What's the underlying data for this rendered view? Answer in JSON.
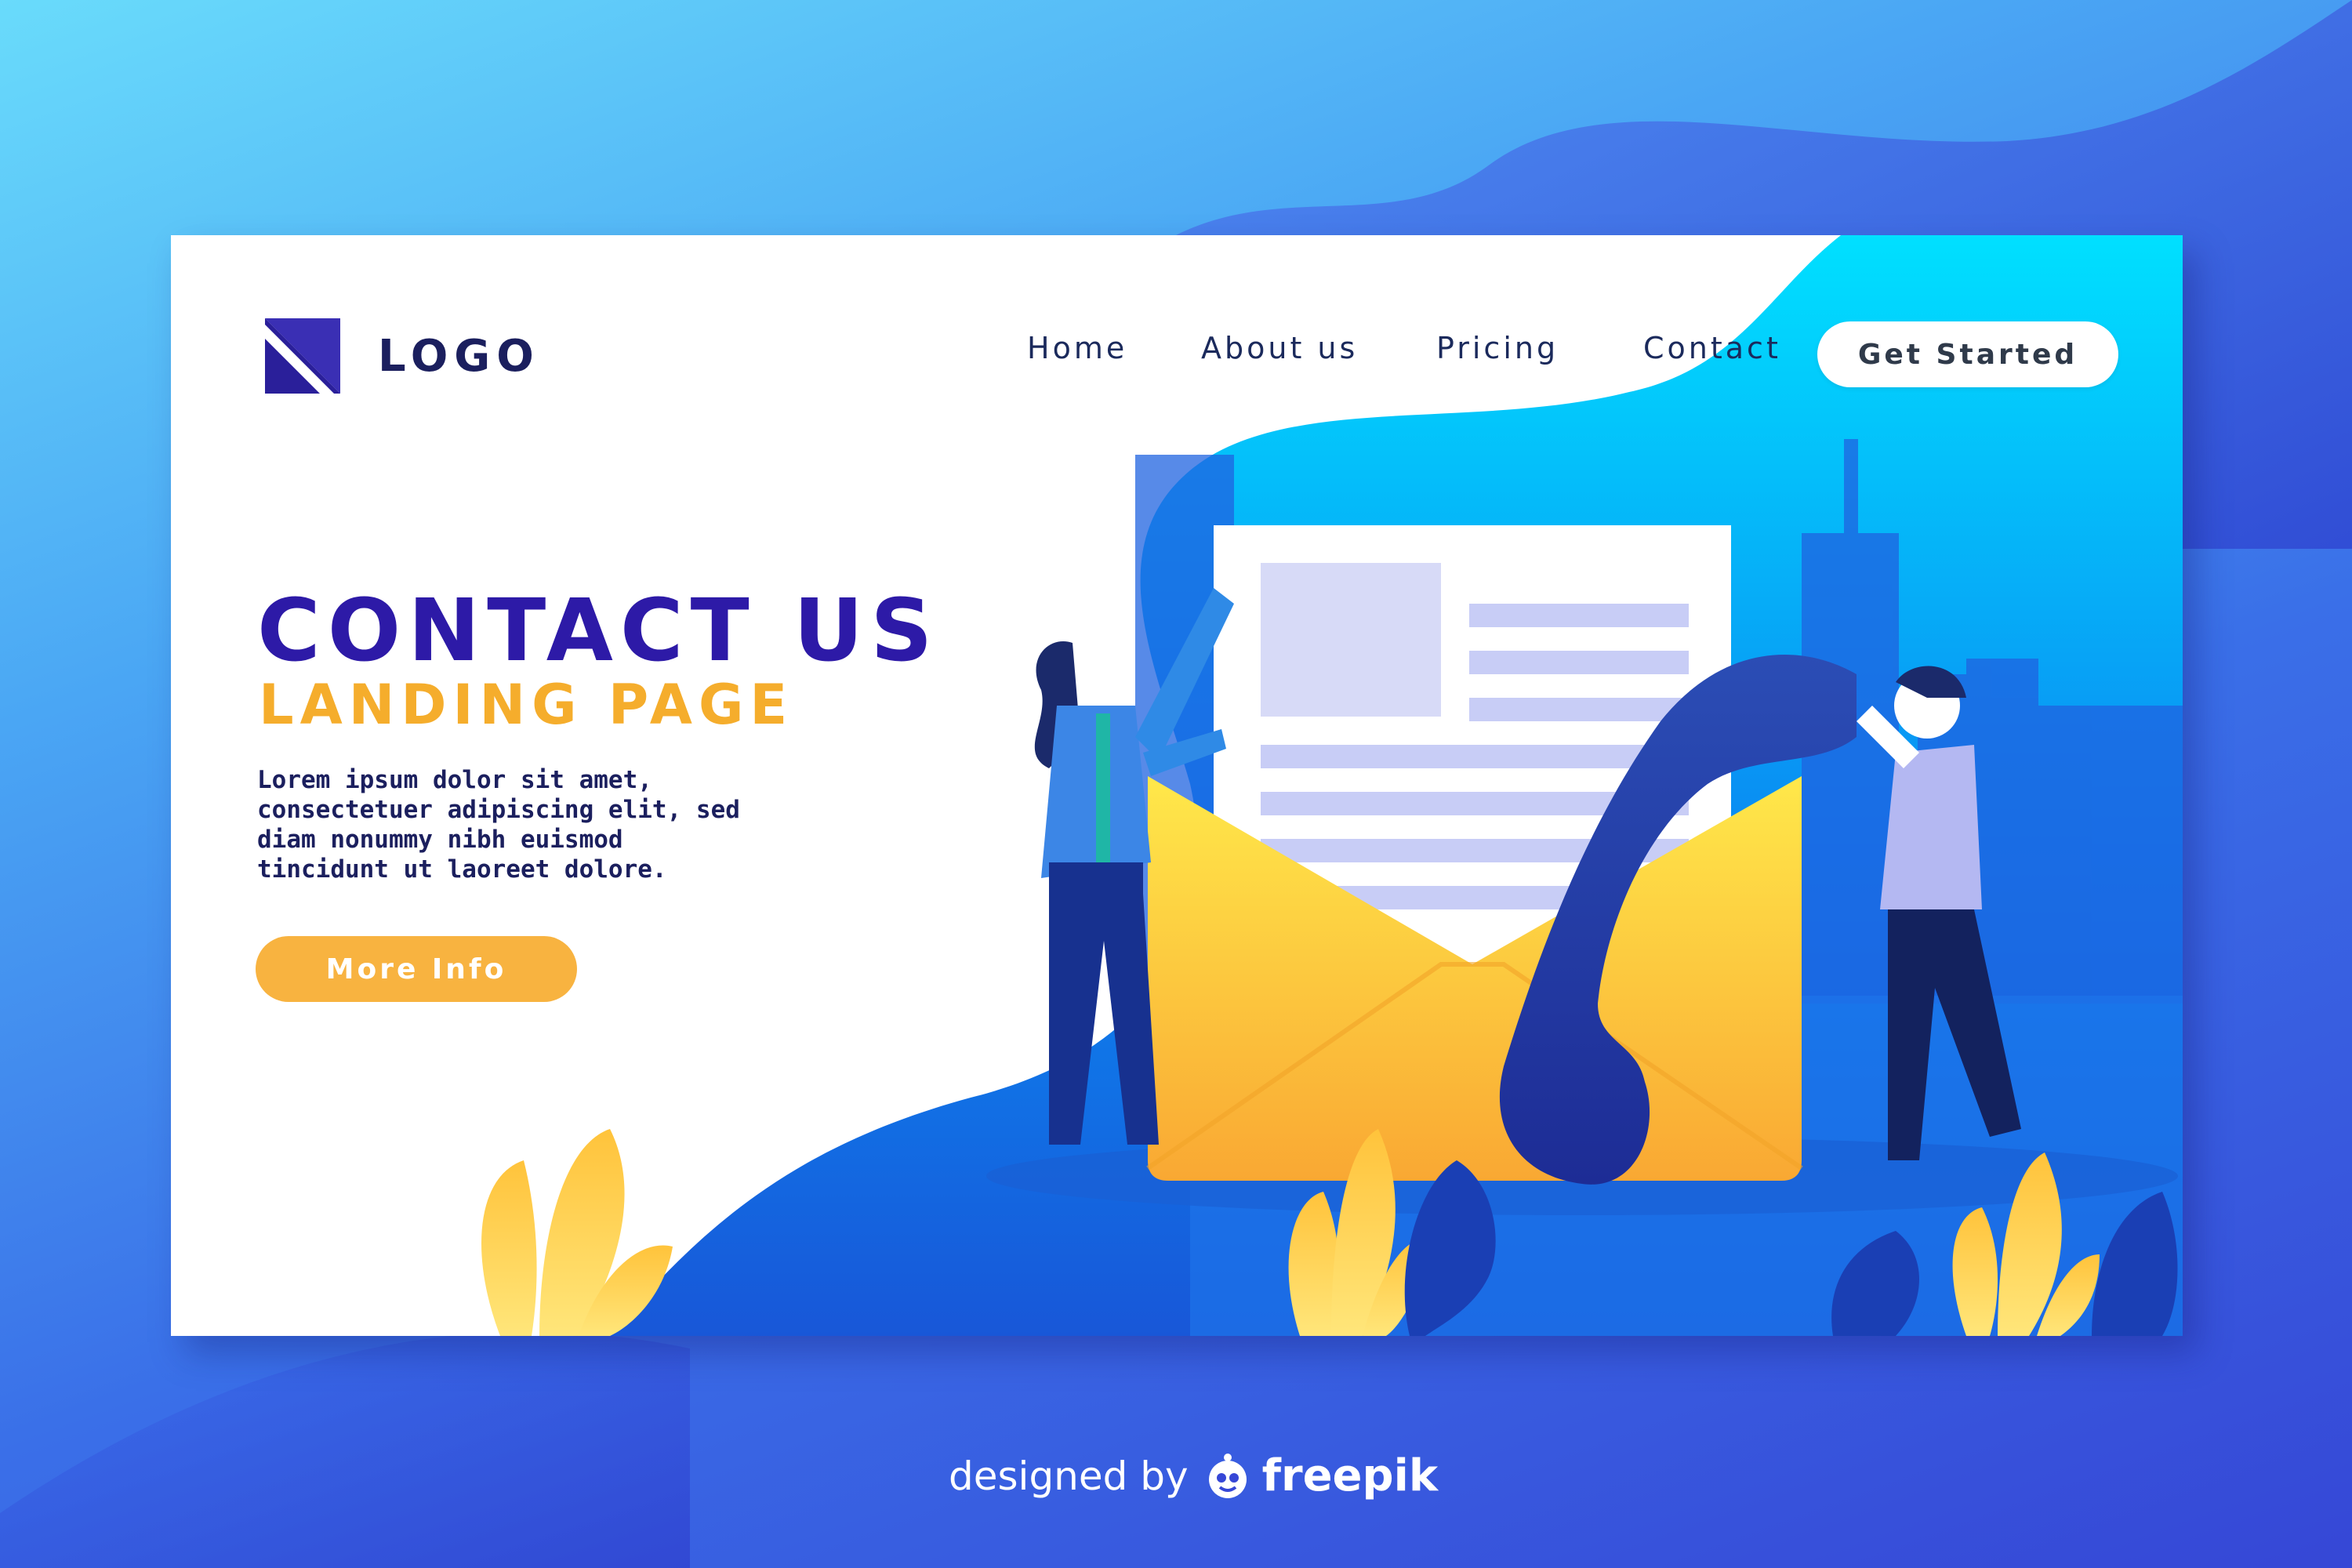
{
  "logo": {
    "text": "LOGO",
    "icon": "square-logo-icon"
  },
  "nav": {
    "items": [
      "Home",
      "About us",
      "Pricing",
      "Contact"
    ],
    "cta_label": "Get Started"
  },
  "hero": {
    "title": "CONTACT US",
    "subtitle": "LANDING PAGE",
    "body_lines": [
      "Lorem ipsum dolor sit amet,",
      "consectetuer adipiscing elit, sed",
      "diam nonummy nibh euismod",
      "tincidunt ut laoreet dolore."
    ],
    "button_label": "More Info"
  },
  "footer": {
    "credit_text": "designed by",
    "brand": "freepik",
    "brand_icon": "freepik-mascot-icon"
  },
  "colors": {
    "title": "#2d1aa7",
    "subtitle": "#f5ad2c",
    "button": "#f8b340",
    "text_dark": "#1b1f5e",
    "background": "#3a6fe8"
  }
}
